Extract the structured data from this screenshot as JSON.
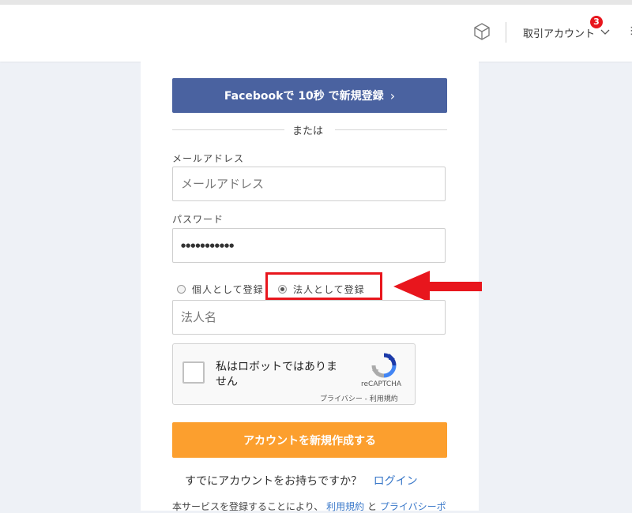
{
  "header": {
    "account_label": "取引アカウント",
    "badge_count": "3",
    "more": "⋮",
    "icons": [
      "cube-icon",
      "chevron-down-icon"
    ]
  },
  "signup": {
    "facebook_button": "Facebookで 10秒 で新規登録",
    "facebook_arrow": "›",
    "or_text": "または",
    "email_label": "メールアドレス",
    "email_placeholder": "メールアドレス",
    "password_label": "パスワード",
    "password_value": "●●●●●●●●●●●",
    "account_type_options": [
      "個人として登録",
      "法人として登録"
    ],
    "account_type_selected": "法人として登録",
    "company_placeholder": "法人名",
    "captcha_text": "私はロボットではありません",
    "captcha_brand": "reCAPTCHA",
    "captcha_links": "プライバシー - 利用規約",
    "create_button": "アカウントを新規作成する",
    "have_account": "すでにアカウントをお持ちですか？",
    "login_link": "ログイン",
    "terms_prefix": "本サービスを登録することにより、",
    "terms_link1": "利用規約",
    "terms_and": "と",
    "terms_link2": "プライバシーポ"
  },
  "colors": {
    "facebook": "#4a62a0",
    "create": "#fc9f2e",
    "highlight": "#e8161d",
    "link": "#3a78c9"
  }
}
